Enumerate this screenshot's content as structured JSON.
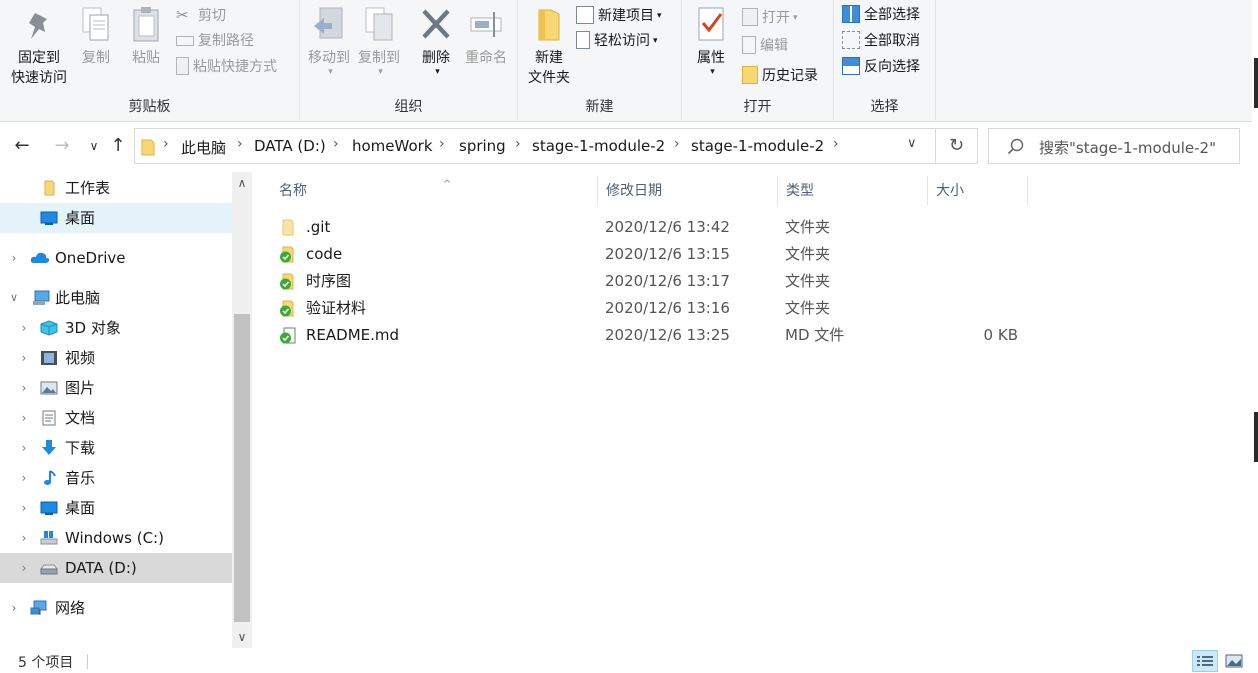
{
  "ribbon": {
    "clipboard": {
      "label": "剪贴板",
      "pin_line1": "固定到",
      "pin_line2": "快速访问",
      "copy": "复制",
      "paste": "粘贴",
      "cut": "剪切",
      "copy_path": "复制路径",
      "paste_shortcut": "粘贴快捷方式"
    },
    "organize": {
      "label": "组织",
      "move_to": "移动到",
      "copy_to": "复制到",
      "delete": "删除",
      "rename": "重命名"
    },
    "new": {
      "label": "新建",
      "new_folder_line1": "新建",
      "new_folder_line2": "文件夹",
      "new_item": "新建项目",
      "easy_access": "轻松访问"
    },
    "open": {
      "label": "打开",
      "properties": "属性",
      "open": "打开",
      "edit": "编辑",
      "history": "历史记录"
    },
    "select": {
      "label": "选择",
      "select_all": "全部选择",
      "select_none": "全部取消",
      "invert": "反向选择"
    }
  },
  "address": {
    "crumbs": [
      "此电脑",
      "DATA (D:)",
      "homeWork",
      "spring",
      "stage-1-module-2",
      "stage-1-module-2"
    ],
    "search_placeholder": "搜索\"stage-1-module-2\""
  },
  "sidebar": {
    "items": [
      {
        "label": "工作表",
        "icon": "folder-icon"
      },
      {
        "label": "桌面",
        "icon": "desktop-icon"
      },
      {
        "label": "OneDrive",
        "icon": "cloud-icon"
      },
      {
        "label": "此电脑",
        "icon": "computer-icon"
      },
      {
        "label": "3D 对象",
        "icon": "cube-icon"
      },
      {
        "label": "视频",
        "icon": "video-icon"
      },
      {
        "label": "图片",
        "icon": "picture-icon"
      },
      {
        "label": "文档",
        "icon": "document-icon"
      },
      {
        "label": "下载",
        "icon": "download-icon"
      },
      {
        "label": "音乐",
        "icon": "music-icon"
      },
      {
        "label": "桌面",
        "icon": "desktop-icon"
      },
      {
        "label": "Windows (C:)",
        "icon": "drive-c-icon"
      },
      {
        "label": "DATA (D:)",
        "icon": "drive-d-icon"
      },
      {
        "label": "网络",
        "icon": "network-icon"
      }
    ]
  },
  "columns": {
    "name": "名称",
    "date": "修改日期",
    "type": "类型",
    "size": "大小"
  },
  "files": [
    {
      "name": ".git",
      "date": "2020/12/6 13:42",
      "type": "文件夹",
      "size": ""
    },
    {
      "name": "code",
      "date": "2020/12/6 13:15",
      "type": "文件夹",
      "size": ""
    },
    {
      "name": "时序图",
      "date": "2020/12/6 13:17",
      "type": "文件夹",
      "size": ""
    },
    {
      "name": "验证材料",
      "date": "2020/12/6 13:16",
      "type": "文件夹",
      "size": ""
    },
    {
      "name": "README.md",
      "date": "2020/12/6 13:25",
      "type": "MD 文件",
      "size": "0 KB"
    }
  ],
  "status": {
    "count": "5 个项目"
  },
  "colors": {
    "selection_light": "#e5f3fb",
    "selection_gray": "#d9d9d9",
    "folder_yellow": "#f8d775",
    "sync_green": "#3aaa35",
    "accent_blue": "#0078d7"
  }
}
